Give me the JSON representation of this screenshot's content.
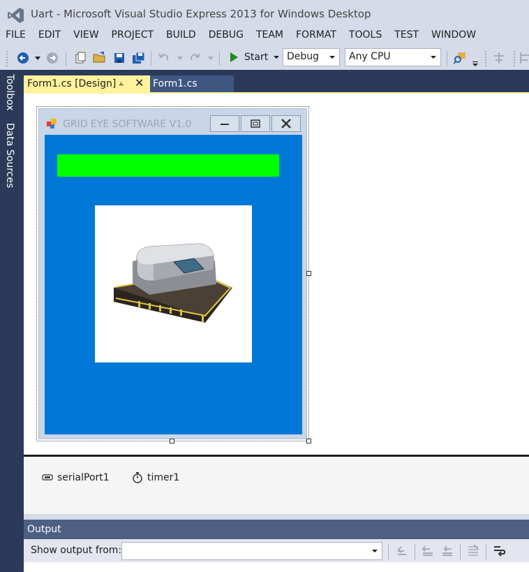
{
  "window": {
    "title": "Uart - Microsoft Visual Studio Express 2013 for Windows Desktop"
  },
  "menu": [
    "FILE",
    "EDIT",
    "VIEW",
    "PROJECT",
    "BUILD",
    "DEBUG",
    "TEAM",
    "FORMAT",
    "TOOLS",
    "TEST",
    "WINDOW"
  ],
  "toolbar": {
    "start_label": "Start",
    "configuration": "Debug",
    "platform": "Any CPU"
  },
  "side_tabs": [
    "Toolbox",
    "Data Sources"
  ],
  "doc_tabs": {
    "active": "Form1.cs [Design]",
    "inactive": "Form1.cs"
  },
  "form": {
    "title": "GRID EYE SOFTWARE V1.0",
    "back_color": "#0078d7",
    "label_color": "#00ff00"
  },
  "tray": {
    "items": [
      "serialPort1",
      "timer1"
    ]
  },
  "output": {
    "title": "Output",
    "show_from_label": "Show output from:",
    "show_from_value": ""
  },
  "colors": {
    "chrome": "#d6dbe9",
    "dock": "#2b3a58",
    "active_tab": "#fff29d",
    "output_header": "#4d6082"
  }
}
